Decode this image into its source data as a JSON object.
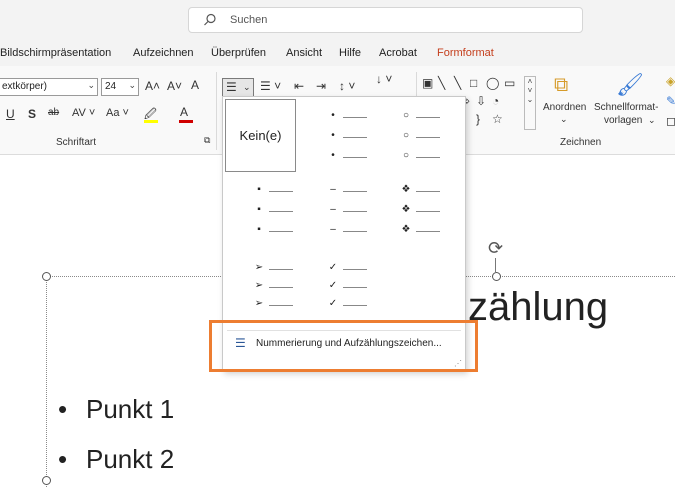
{
  "search": {
    "placeholder": "Suchen"
  },
  "menu": {
    "items": [
      "Bildschirmpräsentation",
      "Aufzeichnen",
      "Überprüfen",
      "Ansicht",
      "Hilfe",
      "Acrobat"
    ],
    "active": "Formformat"
  },
  "ribbon": {
    "font_name": "extkörper)",
    "font_size": "24",
    "groups": {
      "font": "Schriftart",
      "drawing": "Zeichnen"
    },
    "buttons": {
      "arrange": "Anordnen",
      "quick_styles_line1": "Schnellformat-",
      "quick_styles_line2": "vorlagen"
    }
  },
  "bullet_dropdown": {
    "none_label": "Kein(e)",
    "bullet_styles": [
      [
        "•",
        "•",
        "•"
      ],
      [
        "○",
        "○",
        "○"
      ],
      [
        "▪",
        "▪",
        "▪"
      ],
      [
        "–",
        "–",
        "–"
      ],
      [
        "❖",
        "❖",
        "❖"
      ],
      [
        "➢",
        "➢",
        "➢"
      ],
      [
        "✓",
        "✓",
        "✓"
      ]
    ],
    "menu_item": "Nummerierung und Aufzählungszeichen..."
  },
  "slide": {
    "title_fragment": "zählung",
    "bullets": [
      "Punkt 1",
      "Punkt 2"
    ]
  },
  "colors": {
    "accent": "#c43e1c",
    "highlight": "#ed7d31"
  }
}
